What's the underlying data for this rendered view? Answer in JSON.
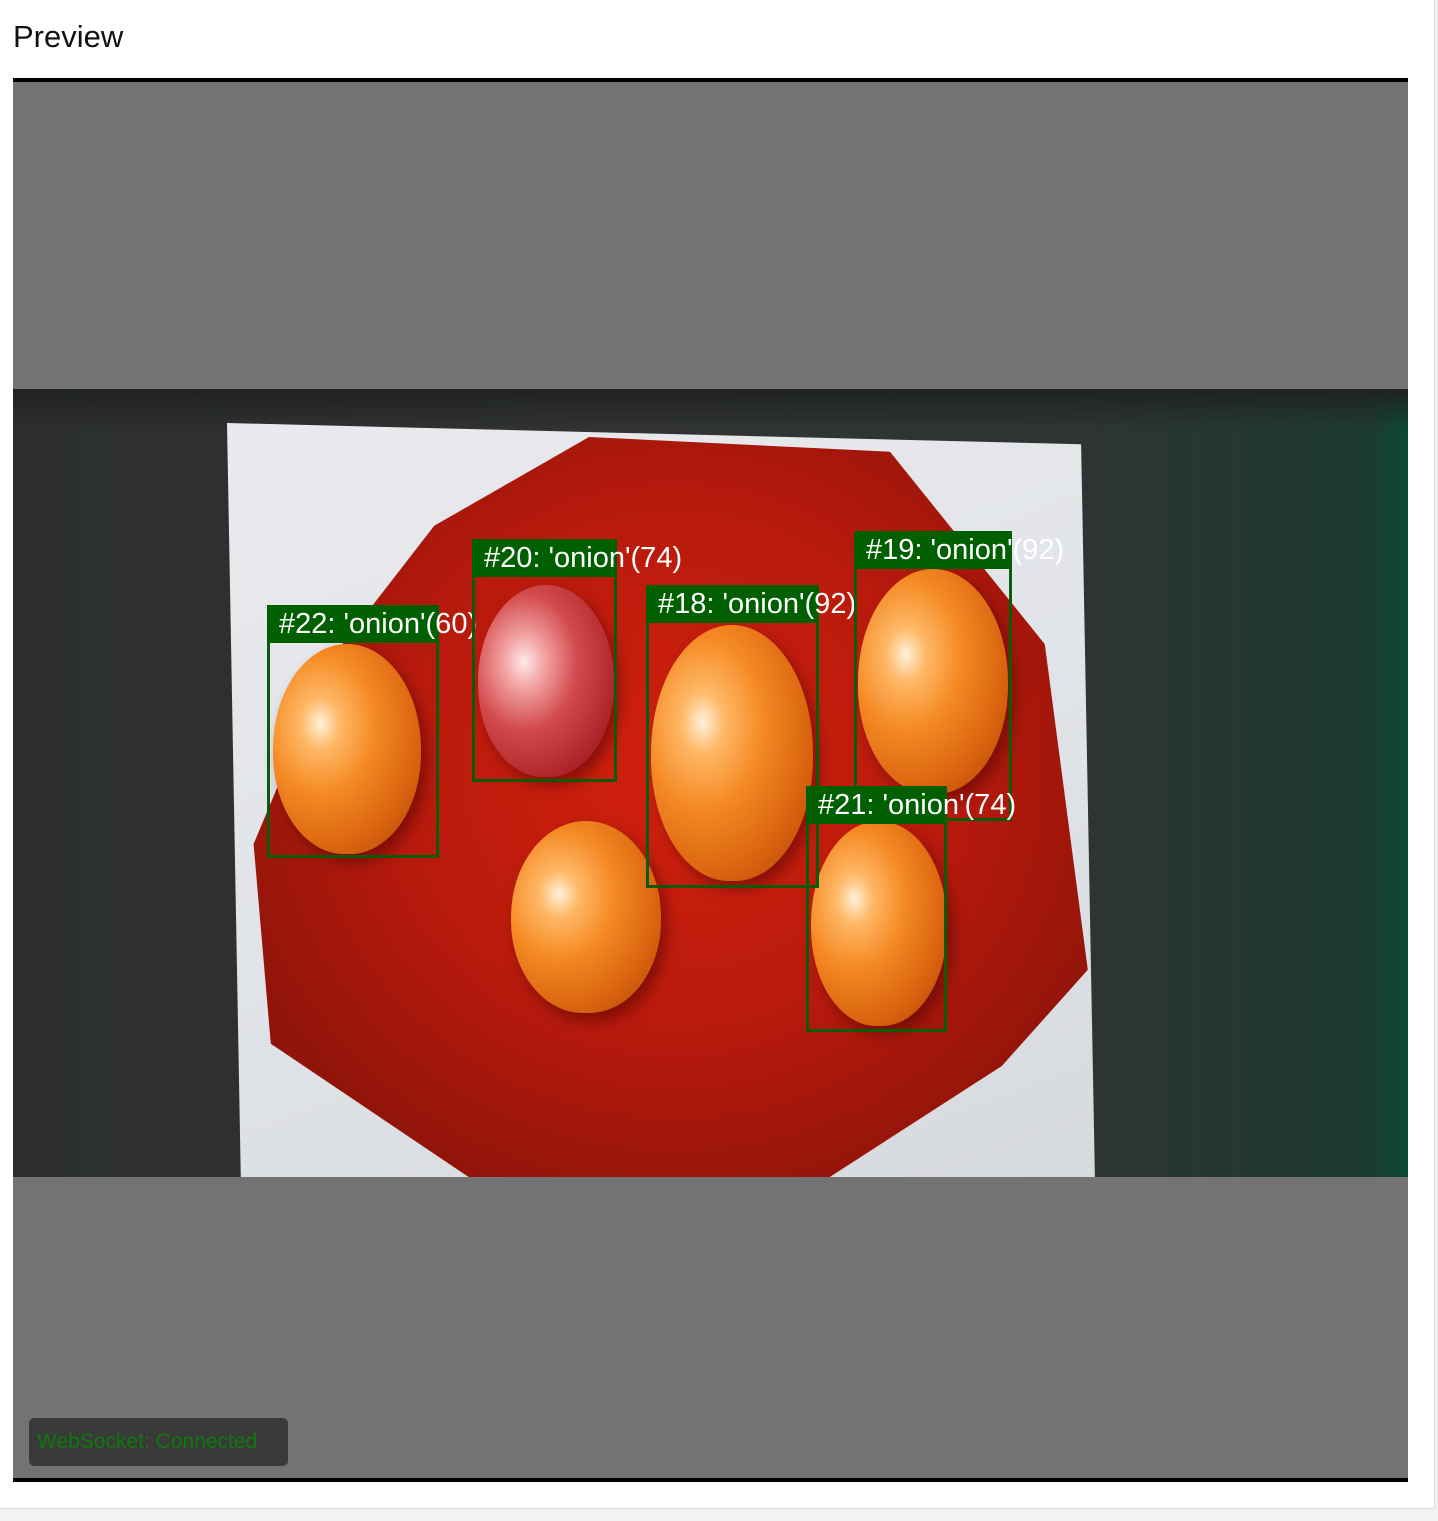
{
  "panel": {
    "title": "Preview"
  },
  "detections": [
    {
      "label": "#22: 'onion'(60)",
      "name": "detection-22"
    },
    {
      "label": "#20: 'onion'(74)",
      "name": "detection-20"
    },
    {
      "label": "#18: 'onion'(92)",
      "name": "detection-18"
    },
    {
      "label": "#19: 'onion'(92)",
      "name": "detection-19"
    },
    {
      "label": "#21: 'onion'(74)",
      "name": "detection-21"
    }
  ],
  "status": {
    "websocket": "WebSocket: Connected"
  },
  "colors": {
    "bbox": "#0a5c0a",
    "label_bg": "#005f00",
    "status_text": "#0c7a0c"
  }
}
